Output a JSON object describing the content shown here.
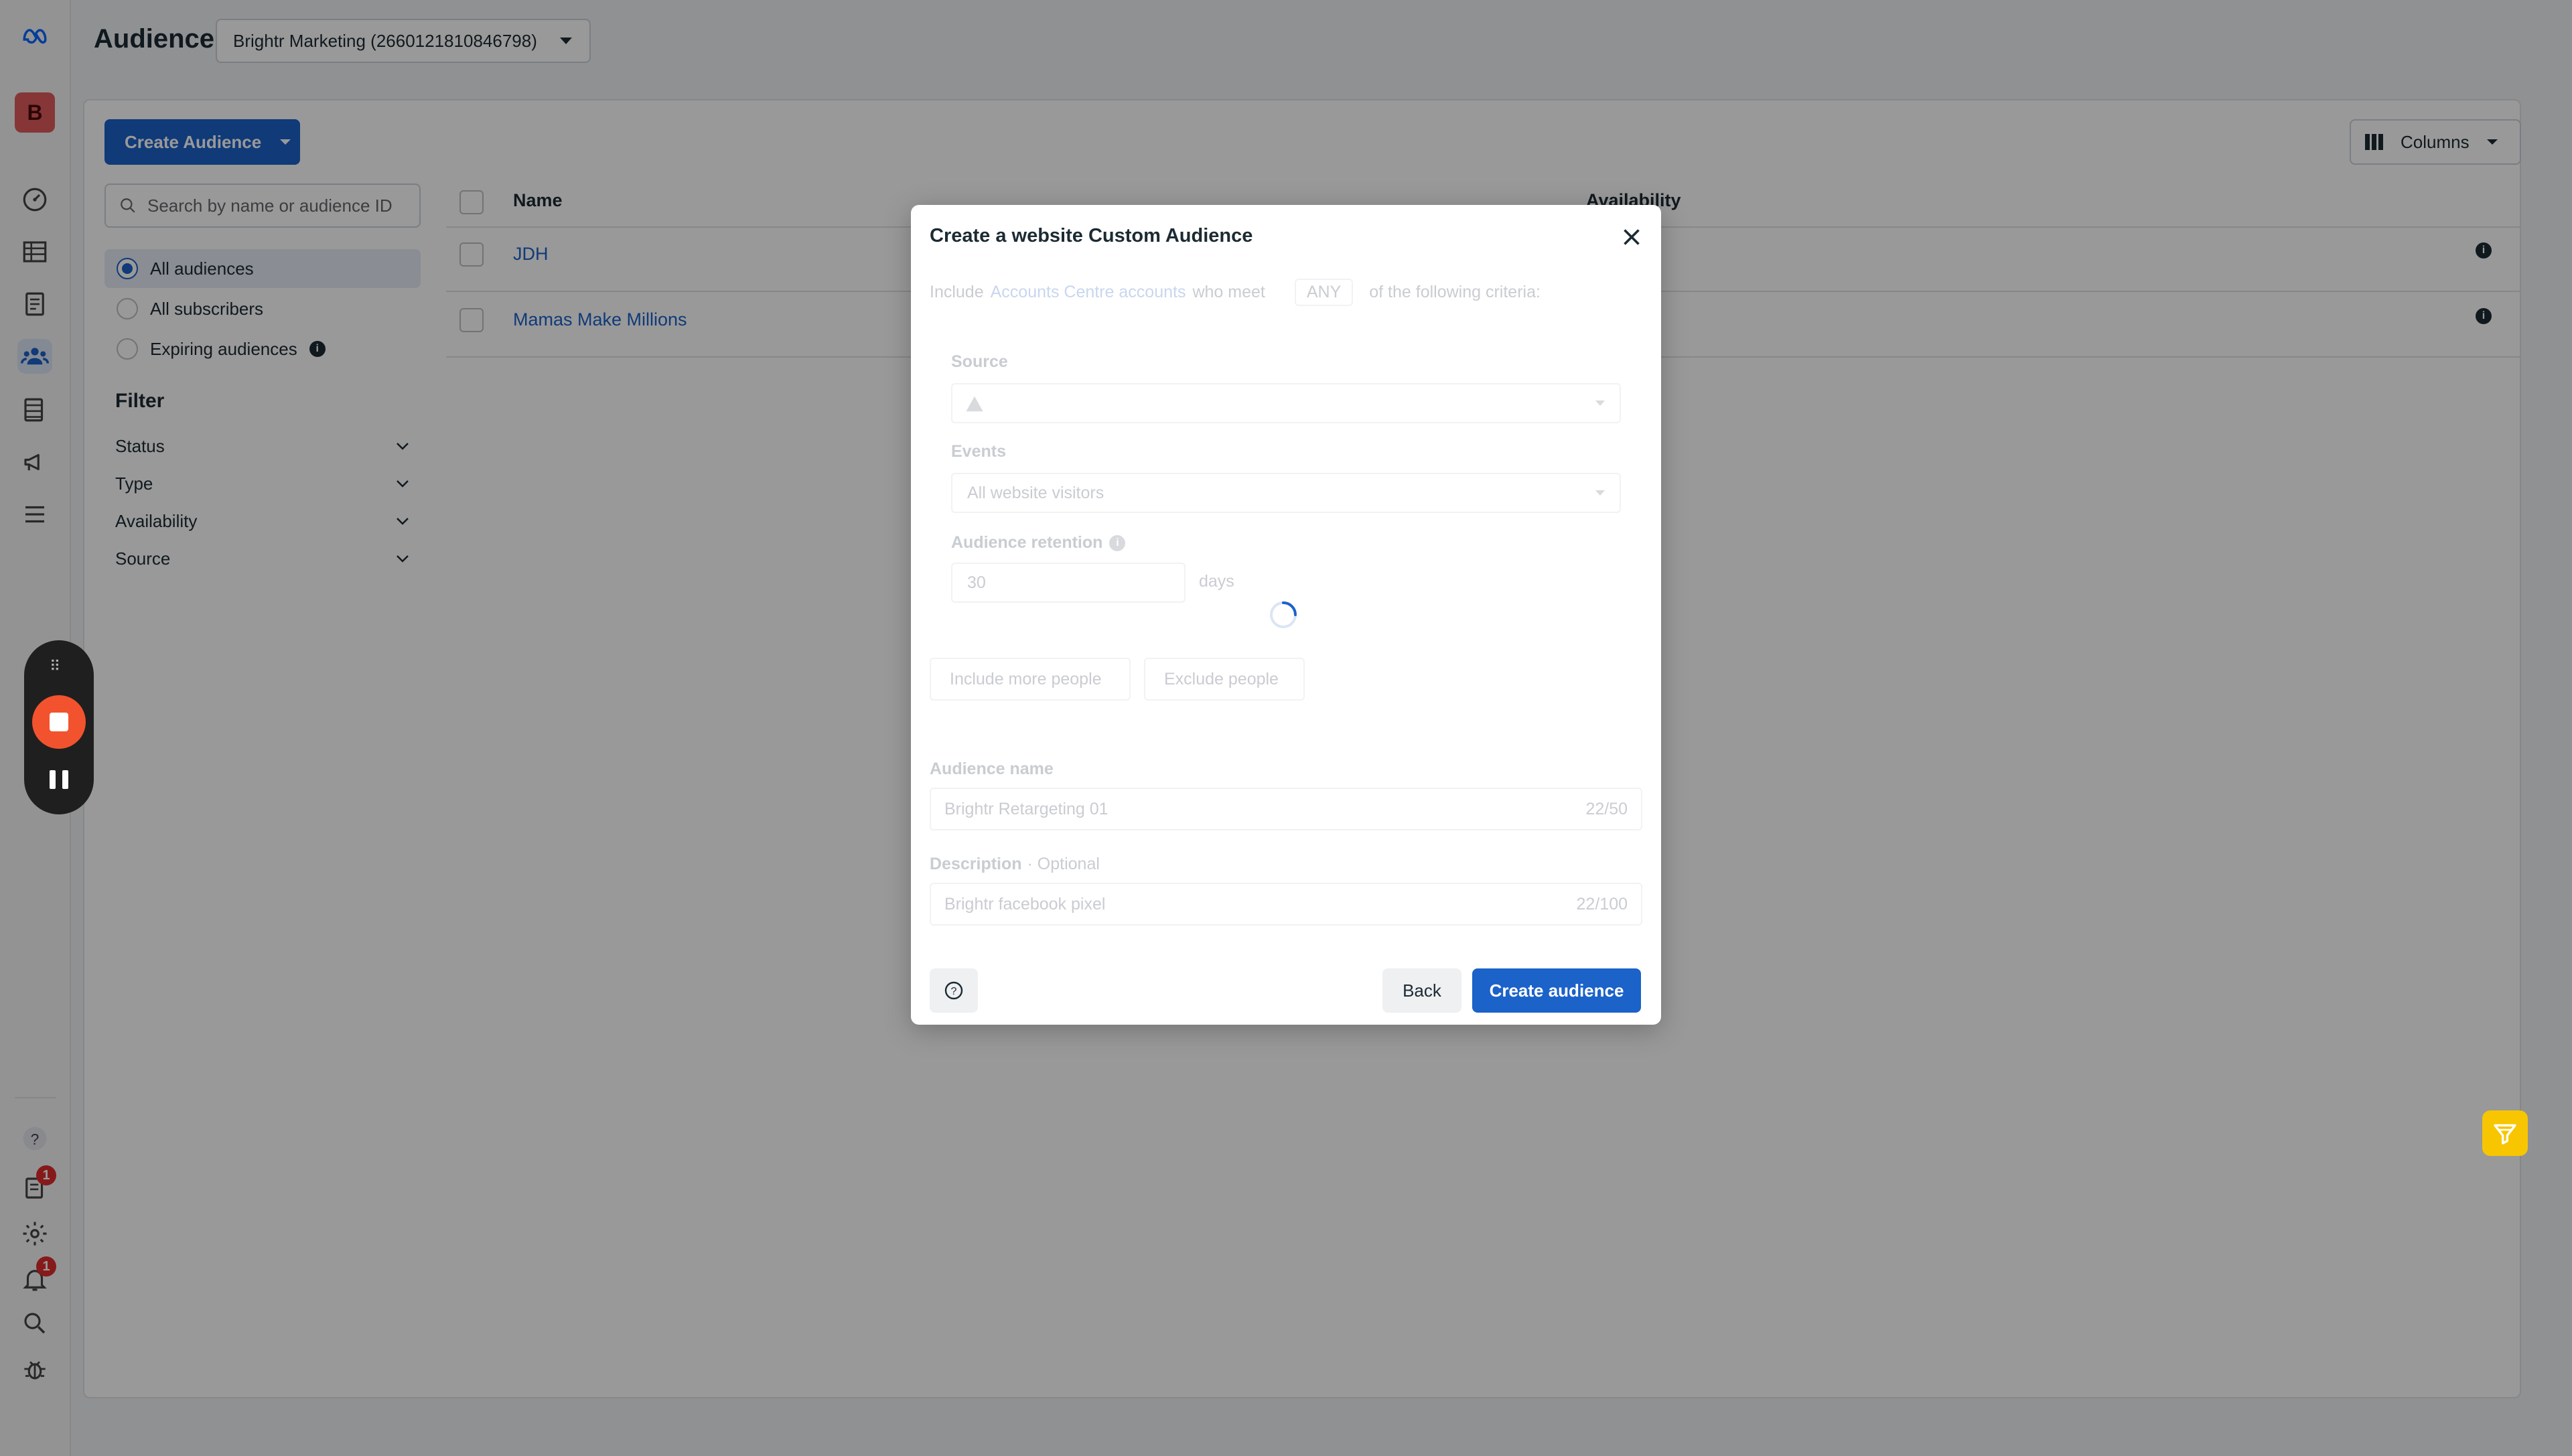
{
  "header": {
    "title": "Audience",
    "account": "Brightr Marketing (2660121810846798)"
  },
  "rail": {
    "avatar_letter": "B",
    "pages_badge": "1",
    "notifications_badge": "1"
  },
  "toolbar": {
    "create_label": "Create Audience",
    "columns_label": "Columns"
  },
  "search": {
    "placeholder": "Search by name or audience ID"
  },
  "audience_filters": [
    "All audiences",
    "All subscribers",
    "Expiring audiences"
  ],
  "filter": {
    "title": "Filter",
    "items": [
      "Status",
      "Type",
      "Availability",
      "Source"
    ]
  },
  "table": {
    "headers": {
      "name": "Name",
      "availability": "Availability"
    },
    "rows": [
      {
        "name": "JDH"
      },
      {
        "name": "Mamas Make Millions"
      }
    ]
  },
  "modal": {
    "title": "Create a website Custom Audience",
    "include_prefix": "Include",
    "include_link": "Accounts Centre accounts",
    "include_mid": "who meet",
    "include_match": "ANY",
    "include_suffix": "of the following criteria:",
    "source_label": "Source",
    "events_label": "Events",
    "events_value": "All website visitors",
    "retention_label": "Audience retention",
    "retention_value": "30",
    "retention_unit": "days",
    "include_more": "Include more people",
    "exclude": "Exclude people",
    "name_label": "Audience name",
    "name_value": "Brightr Retargeting 01",
    "name_count": "22/50",
    "desc_label": "Description",
    "desc_optional": "· Optional",
    "desc_value": "Brightr facebook pixel",
    "desc_count": "22/100",
    "back": "Back",
    "create": "Create audience"
  }
}
